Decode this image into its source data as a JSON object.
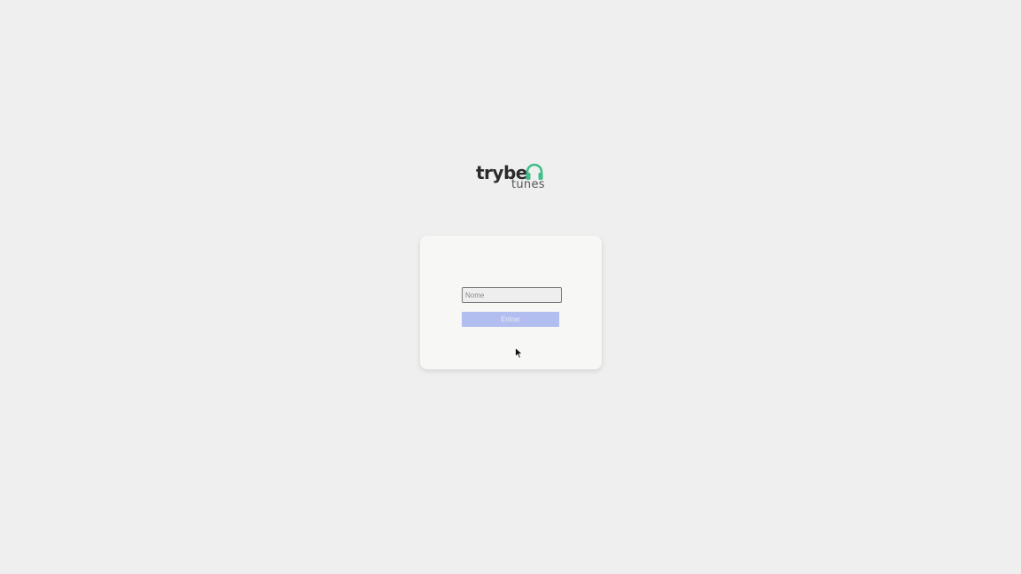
{
  "logo": {
    "word_main": "trybe",
    "word_sub": "tunes",
    "icon": "headphones-icon",
    "icon_color": "#3fbf8a"
  },
  "login": {
    "name_placeholder": "Nome",
    "name_value": "",
    "enter_label": "Entrar",
    "enter_disabled": true,
    "button_color": "#b2bdf0"
  },
  "colors": {
    "background": "#efefef",
    "card": "#f7f7f5"
  }
}
